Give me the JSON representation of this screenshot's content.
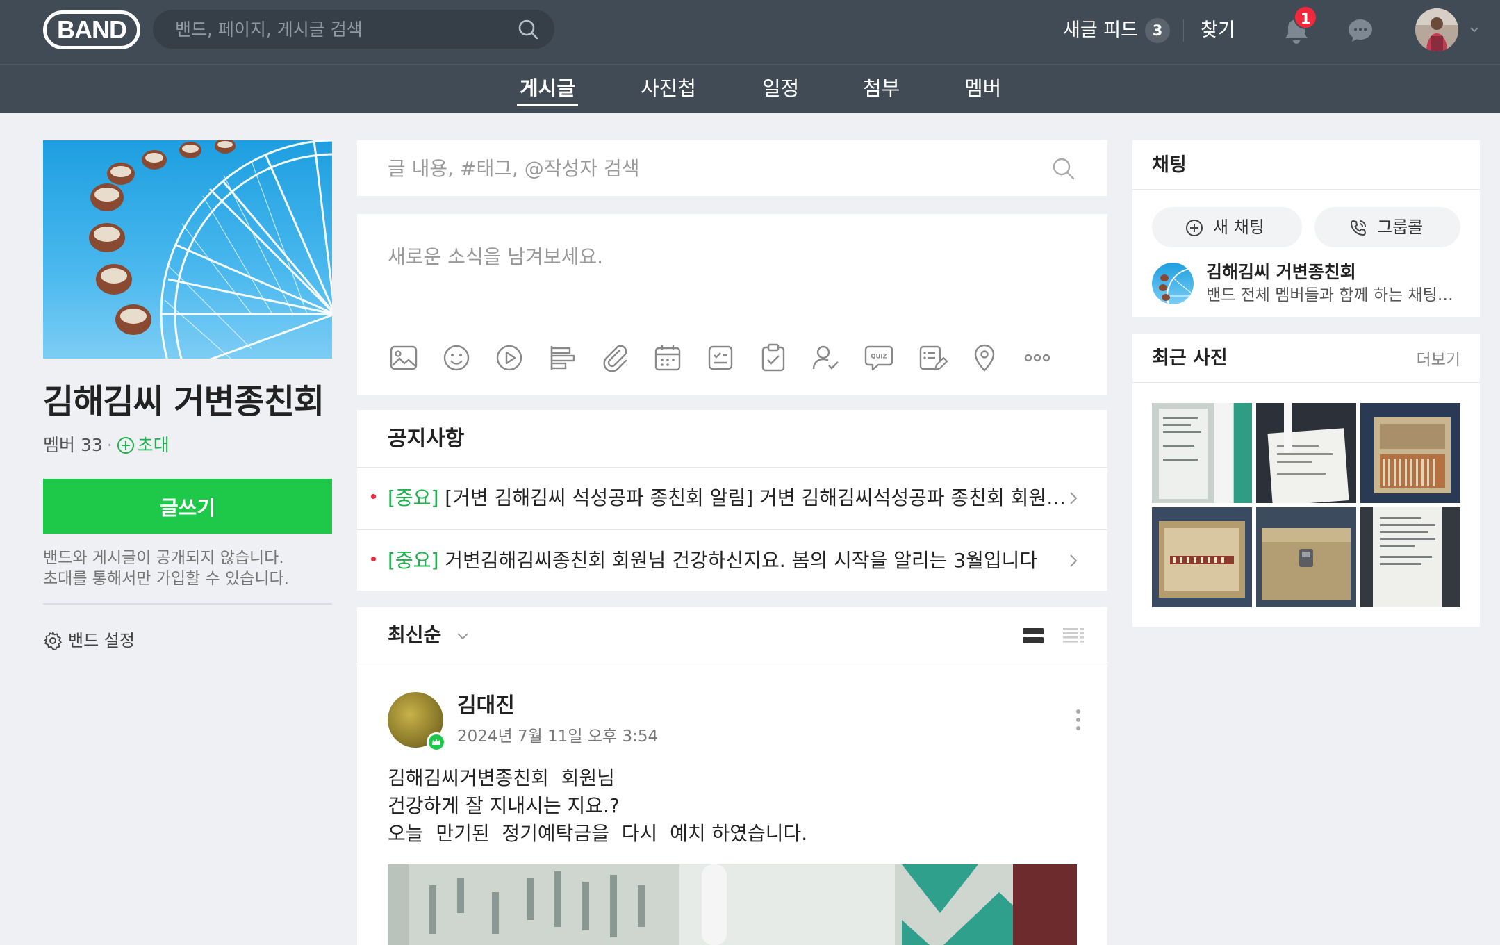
{
  "header": {
    "logo": "BAND",
    "search_placeholder": "밴드, 페이지, 게시글 검색",
    "feed_label": "새글 피드",
    "feed_count": "3",
    "find_label": "찾기",
    "notification_count": "1"
  },
  "tabs": [
    {
      "label": "게시글",
      "active": true
    },
    {
      "label": "사진첩",
      "active": false
    },
    {
      "label": "일정",
      "active": false
    },
    {
      "label": "첨부",
      "active": false
    },
    {
      "label": "멤버",
      "active": false
    }
  ],
  "band": {
    "name": "김해김씨 거변종친회",
    "member_label": "멤버 33",
    "separator": "·",
    "invite_label": "초대",
    "write_button": "글쓰기",
    "privacy_line1": "밴드와 게시글이 공개되지 않습니다.",
    "privacy_line2": "초대를 통해서만 가입할 수 있습니다.",
    "settings_label": "밴드 설정"
  },
  "post_search": {
    "placeholder": "글 내용, #태그, @작성자 검색"
  },
  "composer": {
    "placeholder": "새로운 소식을 남겨보세요.",
    "tools": [
      "photo-icon",
      "sticker-icon",
      "video-icon",
      "vote-icon",
      "attachment-icon",
      "schedule-icon",
      "todo-icon",
      "checklist-icon",
      "attendance-icon",
      "quiz-icon",
      "form-icon",
      "location-icon",
      "more-icon"
    ],
    "quiz_icon_text": "QUIZ"
  },
  "notice": {
    "title": "공지사항",
    "items": [
      {
        "tag": "[중요]",
        "text": " [거변 김해김씨 석성공파 종친회 알림] 거변 김해김씨석성공파 종친회 회원님께"
      },
      {
        "tag": "[중요]",
        "text": " 거변김해김씨종친회 회원님 건강하신지요. 봄의 시작을 알리는 3월입니다"
      }
    ]
  },
  "sort": {
    "label": "최신순"
  },
  "post": {
    "author": "김대진",
    "date": "2024년 7월 11일 오후 3:54",
    "body_lines": [
      "김해김씨거변종친회  회원님",
      "건강하게 잘 지내시는 지요.?",
      "오늘  만기된  정기예탁금을  다시  예치 하였습니다."
    ]
  },
  "chat": {
    "title": "채팅",
    "new_chat": "새 채팅",
    "group_call": "그룹콜",
    "room_name": "김해김씨 거변종친회",
    "room_desc": "밴드 전체 멤버들과 함께 하는 채팅방입니다"
  },
  "photos": {
    "title": "최근 사진",
    "more": "더보기"
  },
  "colors": {
    "header_bg": "#414b55",
    "accent_green": "#1ec94a",
    "badge_red": "#f0283c"
  }
}
